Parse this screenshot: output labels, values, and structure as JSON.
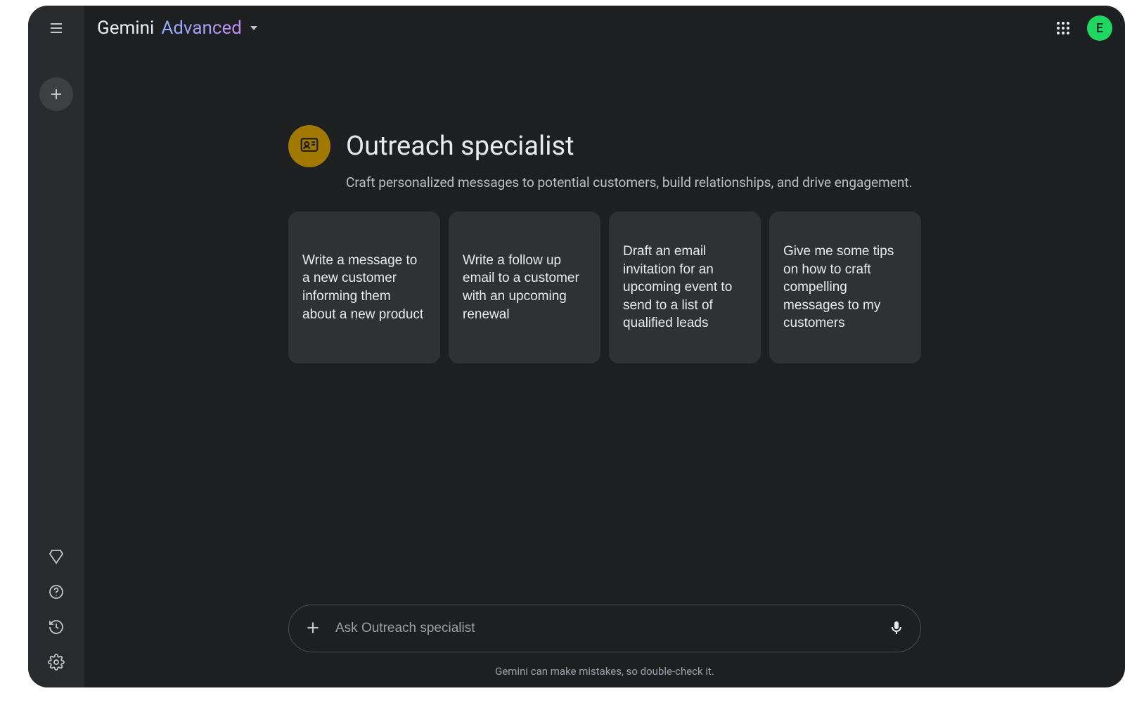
{
  "brand": {
    "name": "Gemini",
    "tier": "Advanced"
  },
  "avatar": {
    "initial": "E",
    "bg": "#1ed760"
  },
  "hero": {
    "title": "Outreach specialist",
    "subtitle": "Craft personalized messages to potential customers, build relationships, and drive engagement."
  },
  "cards": [
    "Write a message to a new customer informing them about a new product",
    "Write a follow up email to a customer with an upcoming renewal",
    "Draft an email invitation for an upcoming event to send to a list of qualified leads",
    "Give me some tips on how to craft compelling messages to my customers"
  ],
  "input": {
    "placeholder": "Ask Outreach specialist"
  },
  "disclaimer": "Gemini can make mistakes, so double-check it.",
  "icons": {
    "menu": "menu-icon",
    "new_chat": "plus-icon",
    "gem": "gem-icon",
    "help": "help-icon",
    "history": "history-icon",
    "settings": "settings-icon",
    "apps": "apps-icon",
    "contact_card": "contact-card-icon",
    "attach": "plus-icon",
    "mic": "mic-icon"
  }
}
